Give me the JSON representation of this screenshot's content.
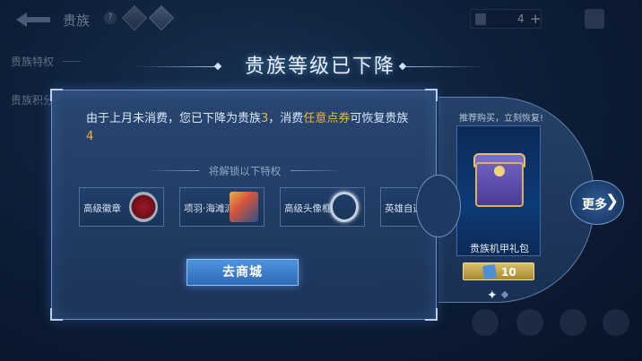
{
  "background": {
    "page_title": "贵族",
    "help_label": "?",
    "side_tabs": [
      "贵族特权",
      "贵族积分"
    ],
    "currency": {
      "value": "4",
      "plus": "+"
    },
    "bottom_labels": [
      "",
      "",
      "",
      ""
    ]
  },
  "dialog": {
    "title": "贵族等级已下降",
    "message_parts": {
      "p1": "由于上月未消费，您已下降为贵族",
      "level_low": "3",
      "p2": "，消费",
      "highlight": "任意点券",
      "p3": "可恢复贵族",
      "level_high": "4"
    },
    "subhead": "将解锁以下特权",
    "privileges": [
      {
        "label": "高级徽章",
        "icon": "badge-icon"
      },
      {
        "label": "项羽·海滩派对",
        "icon": "hero-skin-icon"
      },
      {
        "label": "高级头像框",
        "icon": "avatar-frame-icon"
      },
      {
        "label": "英雄自选",
        "icon": "hero-select-icon"
      }
    ],
    "go_button": "去商城"
  },
  "side": {
    "recommend": "推荐购买，立刻恢复!",
    "pack_name": "贵族机甲礼包",
    "price": "10",
    "more_label": "更多",
    "more_arrow": "❯"
  },
  "colors": {
    "highlight": "#f0b43c",
    "button": "#3a7fcc",
    "price": "#c9ab4c"
  }
}
